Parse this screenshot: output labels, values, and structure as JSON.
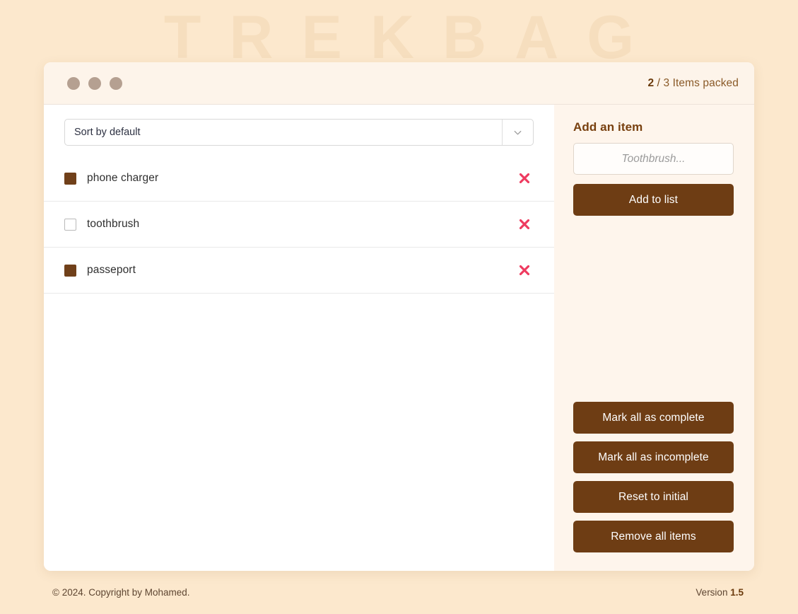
{
  "watermark": {
    "text": "TREKBAG"
  },
  "header": {
    "window_dots": [
      "dot-1",
      "dot-2",
      "dot-3"
    ],
    "counter": {
      "packed": "2",
      "separator": "/",
      "total_and_label": "3 Items packed"
    }
  },
  "list_panel": {
    "sort_select": {
      "value": "Sort by default",
      "icon": "chevron-down-icon"
    },
    "items": [
      {
        "label": "phone charger",
        "checked": true,
        "delete_icon": "close-x-icon"
      },
      {
        "label": "toothbrush",
        "checked": false,
        "delete_icon": "close-x-icon"
      },
      {
        "label": "passeport",
        "checked": true,
        "delete_icon": "close-x-icon"
      }
    ]
  },
  "sidebar": {
    "title": "Add an item",
    "input": {
      "value": "",
      "placeholder": "Toothbrush..."
    },
    "add_button": "Add to list",
    "bulk_actions": [
      "Mark all as complete",
      "Mark all as incomplete",
      "Reset to initial",
      "Remove all items"
    ]
  },
  "footer": {
    "copyright": "© 2024. Copyright by Mohamed.",
    "version_label": "Version",
    "version_number": "1.5"
  },
  "colors": {
    "page_background": "#FCE8CD",
    "watermark": "#F6DEBE",
    "card_background": "#FFFFFF",
    "header_background": "#FDF4EA",
    "sidebar_background": "#FEF5EC",
    "brand_brown": "#6E3D14",
    "checkbox_brown": "#70401A",
    "delete_red": "#EE3A5F",
    "window_dot": "#B5A091",
    "heading_brown": "#78400F"
  }
}
